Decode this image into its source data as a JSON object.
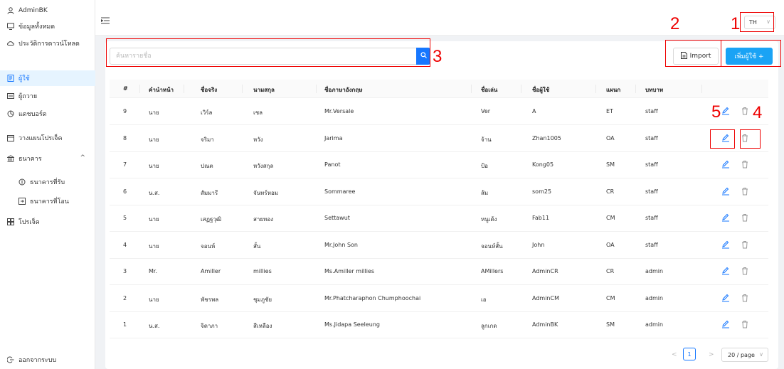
{
  "sidebar": {
    "user": "AdminBK",
    "items": [
      {
        "label": "ข้อมูลทั้งหมด",
        "icon": "monitor-icon"
      },
      {
        "label": "ประวัติการดาวน์โหลด",
        "icon": "cloud-icon"
      },
      {
        "label": "ผู้ใช้",
        "icon": "user-list-icon"
      },
      {
        "label": "ผู้ถวาย",
        "icon": "id-card-icon"
      },
      {
        "label": "แดชบอร์ด",
        "icon": "dashboard-icon"
      },
      {
        "label": "วางแผนโปรเจ็ค",
        "icon": "calendar-icon"
      },
      {
        "label": "ธนาคาร",
        "icon": "bank-icon"
      },
      {
        "label": "ธนาคารที่รับ",
        "icon": "coin-icon"
      },
      {
        "label": "ธนาคารที่โอน",
        "icon": "transfer-icon"
      },
      {
        "label": "โปรเจ็ค",
        "icon": "project-icon"
      }
    ],
    "logout": "ออกจากระบบ"
  },
  "topbar": {
    "language": "TH"
  },
  "toolbar": {
    "search_placeholder": "ค้นหารายชื่อ",
    "import_label": "Import",
    "add_label": "เพิ่มผู้ใช้ +"
  },
  "table": {
    "headers": [
      "#",
      "คำนำหน้า",
      "ชื่อจริง",
      "นามสกุล",
      "ชื่อภาษาอังกฤษ",
      "ชื่อเล่น",
      "ชื่อผู้ใช้",
      "แผนก",
      "บทบาท"
    ],
    "rows": [
      [
        "9",
        "นาย",
        "เวิร์ล",
        "เชล",
        "Mr.Versale",
        "Ver",
        "A",
        "ET",
        "staff"
      ],
      [
        "8",
        "นาย",
        "จริมา",
        "หวัง",
        "Jarima",
        "จ้าน",
        "Zhan1005",
        "OA",
        "staff"
      ],
      [
        "7",
        "นาย",
        "ปณต",
        "หวังสกุล",
        "Panot",
        "ป้อ",
        "Kong05",
        "SM",
        "staff"
      ],
      [
        "6",
        "น.ส.",
        "สัมมารี",
        "จันทร์หอม",
        "Sommaree",
        "ส้ม",
        "som25",
        "CR",
        "staff"
      ],
      [
        "5",
        "นาย",
        "เสฏฐวุฒิ",
        "สายทอง",
        "Settawut",
        "หนูเด้ง",
        "Fab11",
        "CM",
        "staff"
      ],
      [
        "4",
        "นาย",
        "จอนห์",
        "สั้น",
        "Mr.John Son",
        "จอนห์สั้น",
        "John",
        "OA",
        "staff"
      ],
      [
        "3",
        "Mr.",
        "Amiller",
        "millies",
        "Ms.Amiller millies",
        "AMillers",
        "AdminCR",
        "CR",
        "admin"
      ],
      [
        "2",
        "นาย",
        "พัชรพล",
        "ชุมภูชัย",
        "Mr.Phatcharaphon Chumphoochai",
        "เอ",
        "AdminCM",
        "CM",
        "admin"
      ],
      [
        "1",
        "น.ส.",
        "จิดาภา",
        "สีเหลือง",
        "Ms.Jidapa Seeleung",
        "ลูกเกด",
        "AdminBK",
        "SM",
        "admin"
      ]
    ]
  },
  "pagination": {
    "current": "1",
    "page_size": "20 / page"
  },
  "annotations": [
    "1",
    "2",
    "3",
    "4",
    "5"
  ],
  "colors": {
    "primary": "#1677ff",
    "add_button": "#1aa3f5",
    "annotation": "#ee0000"
  }
}
